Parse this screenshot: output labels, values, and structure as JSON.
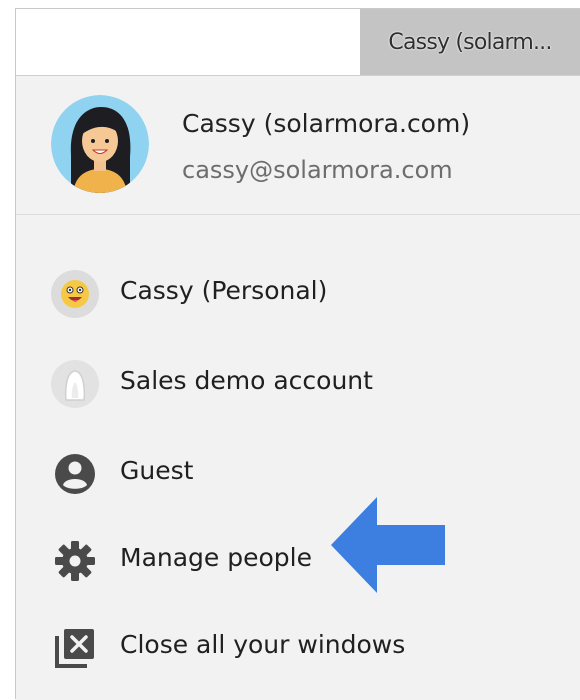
{
  "topbar": {
    "profile_button_label": "Cassy (solarm..."
  },
  "header": {
    "name": "Cassy (solarmora.com)",
    "email": "cassy@solarmora.com",
    "avatar_icon": "woman-avatar-icon"
  },
  "menu": {
    "items": [
      {
        "label": "Cassy (Personal)",
        "icon": "emoji-face-icon"
      },
      {
        "label": "Sales demo account",
        "icon": "default-avatar-icon"
      },
      {
        "label": "Guest",
        "icon": "person-icon"
      },
      {
        "label": "Manage people",
        "icon": "gear-icon"
      },
      {
        "label": "Close all your windows",
        "icon": "close-windows-icon"
      }
    ]
  },
  "annotation": {
    "arrow_icon": "left-arrow-icon",
    "arrow_color": "#3d7fe0"
  }
}
